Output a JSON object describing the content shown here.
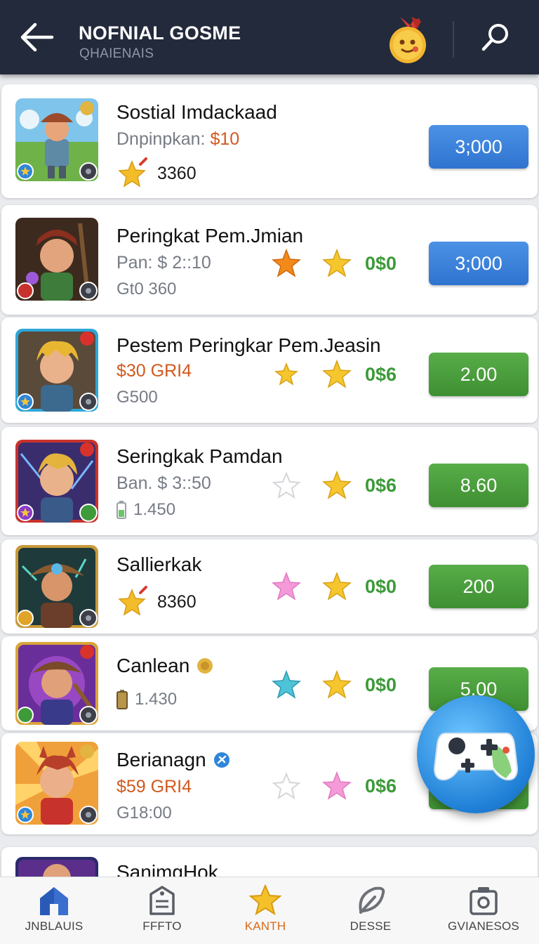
{
  "header": {
    "title": "NOFNIAL GOSME",
    "subtitle": "QHAIENAIS",
    "icons": {
      "back": "arrow-left-icon",
      "medal": "medal-icon",
      "search": "search-icon"
    }
  },
  "items": [
    {
      "name": "Sostial Imdackaad",
      "price_label": "Dnpinpkan:",
      "price_value": "$10",
      "count": "3360",
      "button": "3;000",
      "button_color": "#3a82dc"
    },
    {
      "name": "Peringkat Pem.Jmian",
      "price_label": "Pan: $ 2::10",
      "third": "Gt0 360",
      "score": "0$0",
      "button": "3;000",
      "button_color": "#3a82dc"
    },
    {
      "name": "Pestem Peringkar Pem.Jeasin",
      "price_label": "$30 GRI4",
      "third": "G500",
      "score": "0$6",
      "button": "2.00",
      "button_color": "#4a9e3c"
    },
    {
      "name": "Seringkak Pamdan",
      "price_label": "Ban. $  3::50",
      "third": "1.450",
      "score": "0$6",
      "button": "8.60",
      "button_color": "#4a9e3c"
    },
    {
      "name": "Sallierkak",
      "count": "8360",
      "score": "0$0",
      "button": "200",
      "button_color": "#4a9e3c"
    },
    {
      "name": "Canlean",
      "third": "1.430",
      "score": "0$0",
      "button": "5.00",
      "button_color": "#4a9e3c"
    },
    {
      "name": "Berianagn",
      "price_label": "$59 GRI4",
      "third": "G18:00",
      "score": "0$6"
    },
    {
      "name": "SanimgHok"
    }
  ],
  "fab": {
    "icon": "gamepad-icon"
  },
  "bottom_nav": [
    {
      "label": "JNBLAUIS",
      "icon": "home-icon"
    },
    {
      "label": "FFFTO",
      "icon": "tag-icon"
    },
    {
      "label": "KANTH",
      "icon": "star-icon",
      "active": true
    },
    {
      "label": "DESSE",
      "icon": "leaf-icon"
    },
    {
      "label": "GVIANESOS",
      "icon": "camera-icon"
    }
  ],
  "colors": {
    "header_bg": "#232a3c",
    "accent_orange": "#d66a16",
    "score_green": "#3d9a3a",
    "price_red": "#d0591e"
  }
}
